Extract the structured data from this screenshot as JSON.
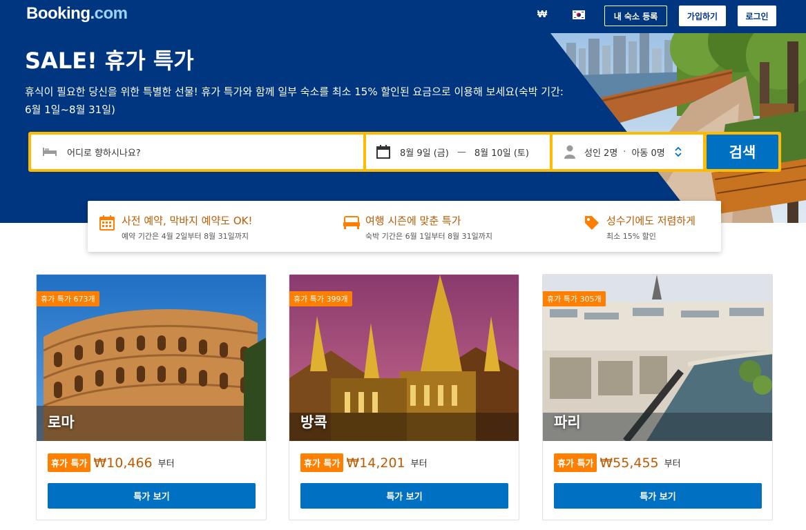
{
  "header": {
    "logo_main": "Booking",
    "logo_dot": ".",
    "logo_tld": "com",
    "currency": "₩",
    "flag_icon": "korea-flag-icon",
    "list_property_label": "내 숙소 등록",
    "register_label": "가입하기",
    "signin_label": "로그인"
  },
  "hero": {
    "title": "SALE! 휴가 특가",
    "subtitle": "휴식이 필요한 당신을 위한 특별한 선물! 휴가 특가와 함께 일부 숙소를 최소 15% 할인된 요금으로 이용해 보세요(숙박 기간: 6월 1일~8월 31일)"
  },
  "search": {
    "destination_placeholder": "어디로 향하시나요?",
    "checkin": "8월 9일 (금)",
    "date_separator": "—",
    "checkout": "8월 10일 (토)",
    "adults": "성인 2명",
    "guest_separator": "·",
    "children": "아동 0명",
    "button_label": "검색"
  },
  "benefits": [
    {
      "icon": "calendar-icon",
      "title": "사전 예약, 막바지 예약도 OK!",
      "desc": "예약 기간은 4월 2일부터 8월 31일까지"
    },
    {
      "icon": "bed-icon",
      "title": "여행 시즌에 맞춘 특가",
      "desc": "숙박 기간은 6월 1일부터 8월 31일까지"
    },
    {
      "icon": "price-tag-icon",
      "title": "성수기에도 저렴하게",
      "desc": "최소 15% 할인"
    }
  ],
  "deals": [
    {
      "badge": "휴가 특가 673개",
      "city": "로마",
      "tag": "휴가 특가",
      "price": "₩10,466",
      "suffix": "부터",
      "button": "특가 보기"
    },
    {
      "badge": "휴가 특가 399개",
      "city": "방콕",
      "tag": "휴가 특가",
      "price": "₩14,201",
      "suffix": "부터",
      "button": "특가 보기"
    },
    {
      "badge": "휴가 특가 305개",
      "city": "파리",
      "tag": "휴가 특가",
      "price": "₩55,455",
      "suffix": "부터",
      "button": "특가 보기"
    }
  ],
  "colors": {
    "brand_blue": "#003580",
    "action_blue": "#0071c2",
    "search_yellow": "#febb02",
    "deal_orange": "#ff8000",
    "benefit_text": "#bc5b01"
  }
}
